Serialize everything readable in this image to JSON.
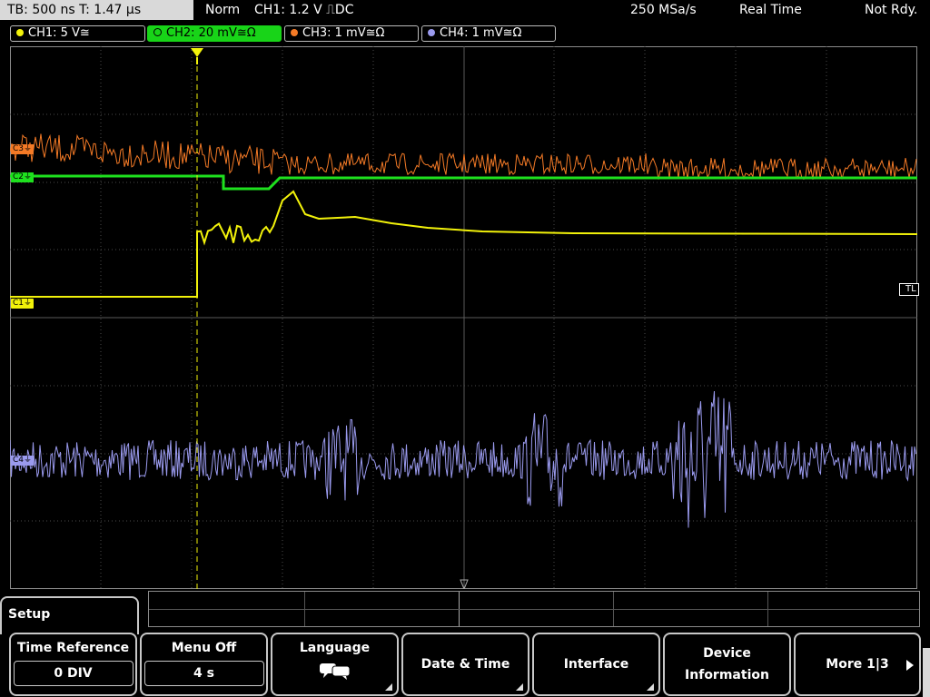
{
  "status": {
    "timebase": "TB: 500 ns   T: 1.47 µs",
    "mode": "Norm",
    "trigger": "CH1: 1.2 V ⎍DC",
    "sample_rate": "250 MSa/s",
    "acq_mode": "Real Time",
    "state": "Not Rdy."
  },
  "channels": [
    {
      "label": "CH1: 5 V≅",
      "color": "#f2f20a"
    },
    {
      "label": "CH2: 20 mV≅Ω",
      "color": "#1ee01e"
    },
    {
      "label": "CH3: 1 mV≅Ω",
      "color": "#f47a26"
    },
    {
      "label": "CH4: 1 mV≅Ω",
      "color": "#9a9aee"
    }
  ],
  "markers": {
    "trigger_level": "TL",
    "ch1": "C1⏚",
    "ch2": "C2⏚",
    "ch3": "C3⏚",
    "ch4": "C4⏚"
  },
  "menu": {
    "title": "Setup",
    "keys": [
      {
        "label": "Time Reference",
        "value": "0 DIV"
      },
      {
        "label": "Menu Off",
        "value": "4 s"
      },
      {
        "label": "Language",
        "icon": "speech-bubble-icon"
      },
      {
        "label": "Date & Time"
      },
      {
        "label": "Interface"
      },
      {
        "label": "Device",
        "label2": "Information"
      },
      {
        "label": "More 1|3"
      }
    ]
  }
}
